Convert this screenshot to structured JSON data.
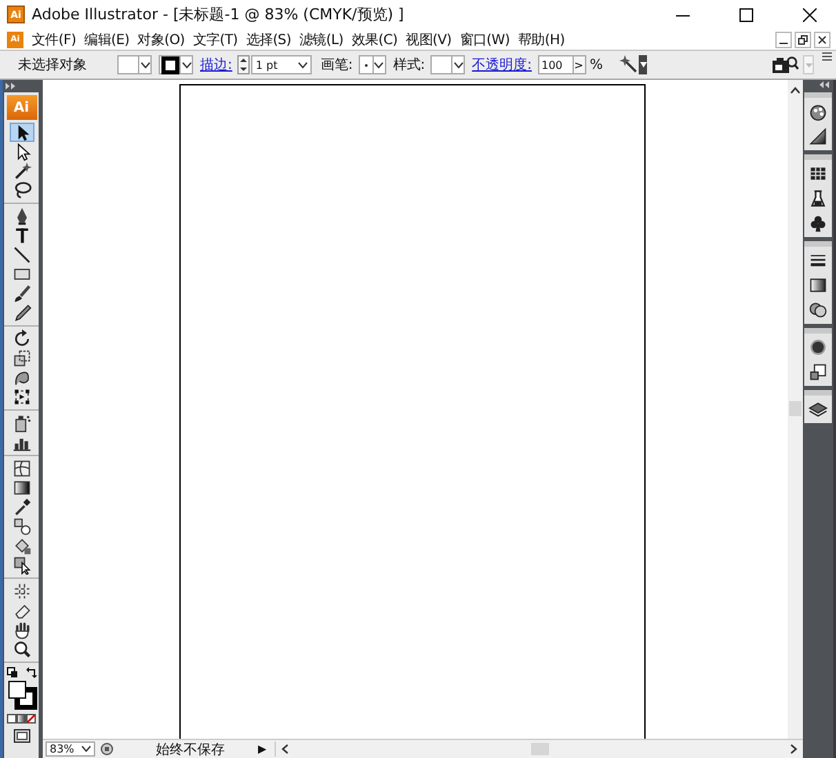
{
  "window": {
    "app_icon": "Ai",
    "title": "Adobe Illustrator - [未标题-1 @ 83% (CMYK/预览) ]"
  },
  "menu_bar": {
    "icon": "Ai",
    "items": [
      "文件(F)",
      "编辑(E)",
      "对象(O)",
      "文字(T)",
      "选择(S)",
      "滤镜(L)",
      "效果(C)",
      "视图(V)",
      "窗口(W)",
      "帮助(H)"
    ]
  },
  "control_bar": {
    "selection": "未选择对象",
    "stroke_label": "描边:",
    "stroke_weight": "1 pt",
    "brush_label": "画笔:",
    "style_label": "样式:",
    "opacity_label": "不透明度:",
    "opacity": "100",
    "opacity_arrow": ">",
    "percent": "%"
  },
  "toolbox": {
    "logo": "Ai",
    "groups": [
      {
        "tools": [
          {
            "selected": true
          },
          {
            "selected": false
          },
          {
            "selected": false
          },
          {
            "selected": false
          }
        ]
      },
      {
        "tools": [
          {
            "selected": false
          },
          {
            "selected": false
          },
          {
            "selected": false
          },
          {
            "selected": false
          },
          {
            "selected": false
          },
          {
            "selected": false
          }
        ]
      },
      {
        "tools": [
          {
            "selected": false
          },
          {
            "selected": false
          },
          {
            "selected": false
          },
          {
            "selected": false
          }
        ]
      },
      {
        "tools": [
          {
            "selected": false
          },
          {
            "selected": false
          }
        ]
      },
      {
        "tools": [
          {
            "selected": false
          },
          {
            "selected": false
          },
          {
            "selected": false
          },
          {
            "selected": false
          },
          {
            "selected": false
          },
          {
            "selected": false
          }
        ]
      },
      {
        "tools": [
          {
            "selected": false
          },
          {
            "selected": false
          },
          {
            "selected": false
          },
          {
            "selected": false
          }
        ]
      }
    ]
  },
  "status_bar": {
    "zoom": "83%",
    "save_status": "始终不保存",
    "arrow": "▶"
  }
}
